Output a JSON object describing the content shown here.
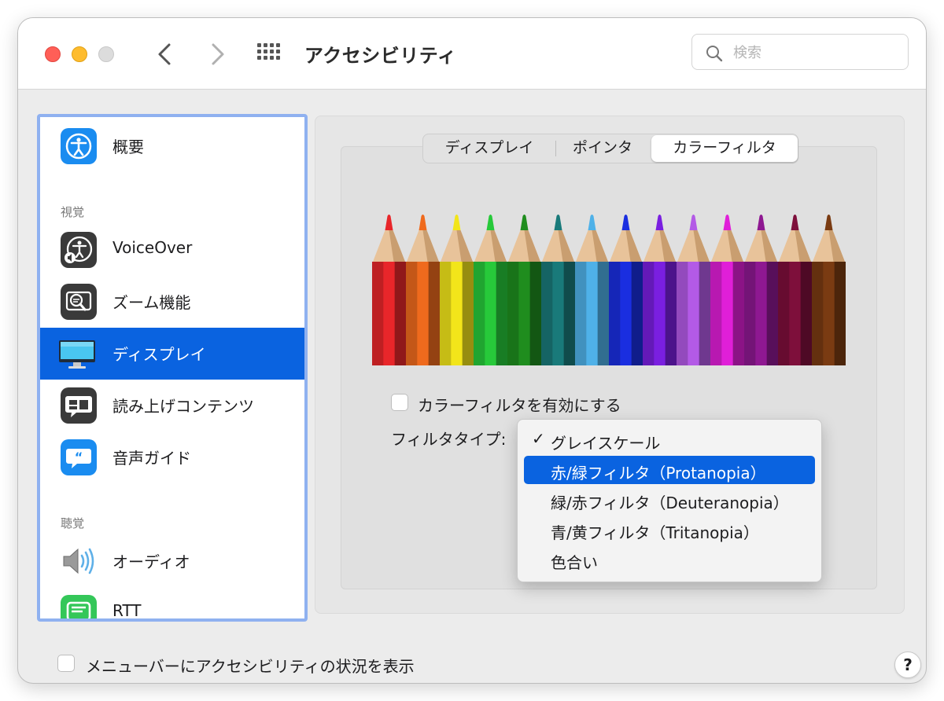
{
  "window": {
    "title": "アクセシビリティ"
  },
  "search": {
    "placeholder": "検索",
    "icon": "magnifier-icon"
  },
  "toolbar": {
    "back_icon": "chevron-left-icon",
    "forward_icon": "chevron-right-icon",
    "grid_icon": "grid-icon"
  },
  "sidebar": {
    "items": [
      {
        "label": "概要",
        "icon": "accessibility-icon"
      },
      {
        "label": "VoiceOver",
        "icon": "voiceover-icon"
      },
      {
        "label": "ズーム機能",
        "icon": "zoom-icon"
      },
      {
        "label": "ディスプレイ",
        "icon": "display-icon",
        "selected": true
      },
      {
        "label": "読み上げコンテンツ",
        "icon": "spoken-content-icon"
      },
      {
        "label": "音声ガイド",
        "icon": "descriptions-icon"
      },
      {
        "label": "オーディオ",
        "icon": "speaker-icon"
      },
      {
        "label": "RTT",
        "icon": "rtt-icon"
      }
    ],
    "sections": [
      "視覚",
      "聴覚"
    ]
  },
  "tabs": [
    "ディスプレイ",
    "ポインタ",
    "カラーフィルタ"
  ],
  "active_tab": "カラーフィルタ",
  "pencil_colors": [
    "#e8262a",
    "#ef6a1d",
    "#f2e51a",
    "#27c93a",
    "#1f8d1e",
    "#197a7a",
    "#4fb1e8",
    "#1a2ee0",
    "#7a1fe0",
    "#b35ae6",
    "#e01fd8",
    "#8e1891",
    "#7e0f3b",
    "#7a3b12"
  ],
  "enable_checkbox": {
    "label": "カラーフィルタを有効にする",
    "checked": false
  },
  "filter_type": {
    "label": "フィルタタイプ:",
    "options": [
      {
        "label": "グレイスケール",
        "checked": true
      },
      {
        "label": "赤/緑フィルタ（Protanopia）",
        "highlighted": true
      },
      {
        "label": "緑/赤フィルタ（Deuteranopia）"
      },
      {
        "label": "青/黄フィルタ（Tritanopia）"
      },
      {
        "label": "色合い"
      }
    ]
  },
  "menubar_checkbox": {
    "label": "メニューバーにアクセシビリティの状況を表示",
    "checked": false
  },
  "help_label": "?",
  "colors": {
    "accent": "#0a63e0",
    "sidebar_border": "#8fb1f0"
  }
}
